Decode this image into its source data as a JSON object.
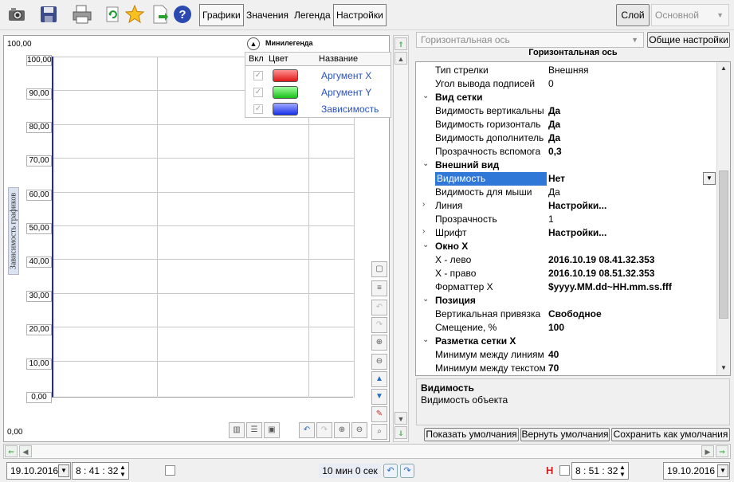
{
  "toolbar": {
    "icons": [
      "camera-icon",
      "save-icon",
      "print-icon",
      "refresh-icon",
      "star-icon",
      "export-icon",
      "help-icon"
    ],
    "tabs": [
      {
        "label": "Графики",
        "active": true
      },
      {
        "label": "Значения",
        "active": false
      },
      {
        "label": "Легенда",
        "active": false
      },
      {
        "label": "Настройки",
        "active": true
      }
    ],
    "layer_button": "Слой",
    "layer_select": "Основной"
  },
  "chart": {
    "top_value": "100,00",
    "bottom_value": "0,00",
    "y_axis_title": "Зависимость графиков",
    "y_ticks": [
      "100,00",
      "90,00",
      "80,00",
      "70,00",
      "60,00",
      "50,00",
      "40,00",
      "30,00",
      "20,00",
      "10,00",
      "0,00"
    ],
    "axis_color": "#2020cc"
  },
  "minilegend": {
    "title": "Минилегенда",
    "headers": {
      "enabled": "Вкл",
      "color": "Цвет",
      "name": "Название"
    },
    "rows": [
      {
        "name": "Аргумент X",
        "color": "#f03030"
      },
      {
        "name": "Аргумент Y",
        "color": "#30d030"
      },
      {
        "name": "Зависимость",
        "color": "#3048f0"
      }
    ]
  },
  "properties": {
    "object_select": "Горизонтальная ось",
    "common_settings": "Общие настройки",
    "title": "Горизонтальная ось",
    "rows": [
      {
        "type": "prop",
        "name": "Тип стрелки",
        "value": "Внешняя",
        "bold": false
      },
      {
        "type": "prop",
        "name": "Угол вывода подписей",
        "value": "0",
        "bold": false
      },
      {
        "type": "cat",
        "name": "Вид сетки",
        "value": ""
      },
      {
        "type": "prop",
        "name": "Видимость вертикальны",
        "value": "Да",
        "bold": true
      },
      {
        "type": "prop",
        "name": "Видимость горизонталь",
        "value": "Да",
        "bold": true
      },
      {
        "type": "prop",
        "name": "Видимость дополнитель",
        "value": "Да",
        "bold": true
      },
      {
        "type": "prop",
        "name": "Прозрачность вспомога",
        "value": "0,3",
        "bold": true
      },
      {
        "type": "cat",
        "name": "Внешний вид",
        "value": ""
      },
      {
        "type": "sel",
        "name": "Видимость",
        "value": "Нет",
        "bold": true
      },
      {
        "type": "prop",
        "name": "Видимость для мыши",
        "value": "Да",
        "bold": false
      },
      {
        "type": "sub",
        "name": "Линия",
        "value": "Настройки...",
        "bold": true
      },
      {
        "type": "prop",
        "name": "Прозрачность",
        "value": "1",
        "bold": false
      },
      {
        "type": "sub",
        "name": "Шрифт",
        "value": "Настройки...",
        "bold": true
      },
      {
        "type": "cat",
        "name": "Окно X",
        "value": ""
      },
      {
        "type": "prop",
        "name": "X - лево",
        "value": "2016.10.19 08.41.32.353",
        "bold": true
      },
      {
        "type": "prop",
        "name": "X - право",
        "value": "2016.10.19 08.51.32.353",
        "bold": true
      },
      {
        "type": "prop",
        "name": "Форматтер X",
        "value": "$yyyy.MM.dd~HH.mm.ss.fff",
        "bold": true
      },
      {
        "type": "cat",
        "name": "Позиция",
        "value": ""
      },
      {
        "type": "prop",
        "name": "Вертикальная привязка",
        "value": "Свободное",
        "bold": true
      },
      {
        "type": "prop",
        "name": "Смещение, %",
        "value": "100",
        "bold": true
      },
      {
        "type": "cat",
        "name": "Разметка сетки X",
        "value": ""
      },
      {
        "type": "prop",
        "name": "Минимум между линиям",
        "value": "40",
        "bold": true
      },
      {
        "type": "prop",
        "name": "Минимум между текстом",
        "value": "70",
        "bold": true
      }
    ],
    "description_title": "Видимость",
    "description_text": "Видимость объекта",
    "buttons": [
      "Показать умолчания",
      "Вернуть умолчания",
      "Сохранить как умолчания"
    ]
  },
  "status": {
    "start_date": "19.10.2016",
    "start_time": "8 : 41 : 32",
    "range": "10 мин 0 сек",
    "h_label": "H",
    "end_time": "8 : 51 : 32",
    "end_date": "19.10.2016"
  }
}
